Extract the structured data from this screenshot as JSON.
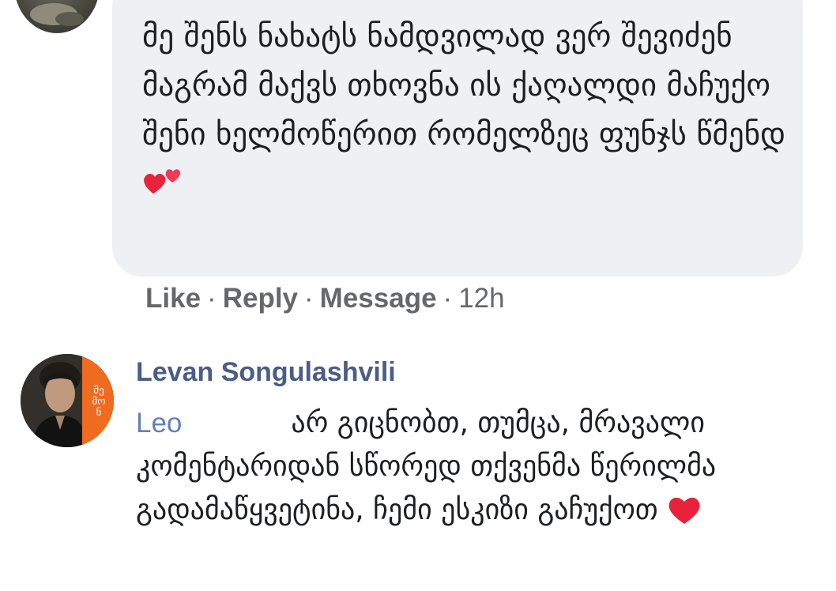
{
  "top_comment": {
    "text": "მე შენს ნახატს ნამდვილად ვერ შევიძენ მაგრამ მაქვს თხოვნა ის ქაღალდი მაჩუქო შენი ხელმოწერით რომელზეც ფუნჯს წმენდ",
    "emoji": "two-hearts-icon"
  },
  "actions": {
    "like": "Like",
    "reply": "Reply",
    "message": "Message",
    "separator": "·",
    "time": "12h"
  },
  "reply_comment": {
    "author": "Levan Songulashvili",
    "avatar_badge": "მე მო ნ",
    "mention": "Leo",
    "text": "არ გიცნობთ, თუმცა, მრავალი კომენტარიდან სწორედ თქვენმა წერილმა გადამაწყვეტინა, ჩემი ესკიზი გაჩუქოთ",
    "emoji": "red-heart-icon"
  },
  "colors": {
    "bubble_bg": "#eff0f3",
    "name_blue": "#4b5d86",
    "mention_blue": "#5f7fbd",
    "meta_gray": "#65676b",
    "heart_red": "#e8223b",
    "avatar_orange": "#ef6b1f"
  }
}
